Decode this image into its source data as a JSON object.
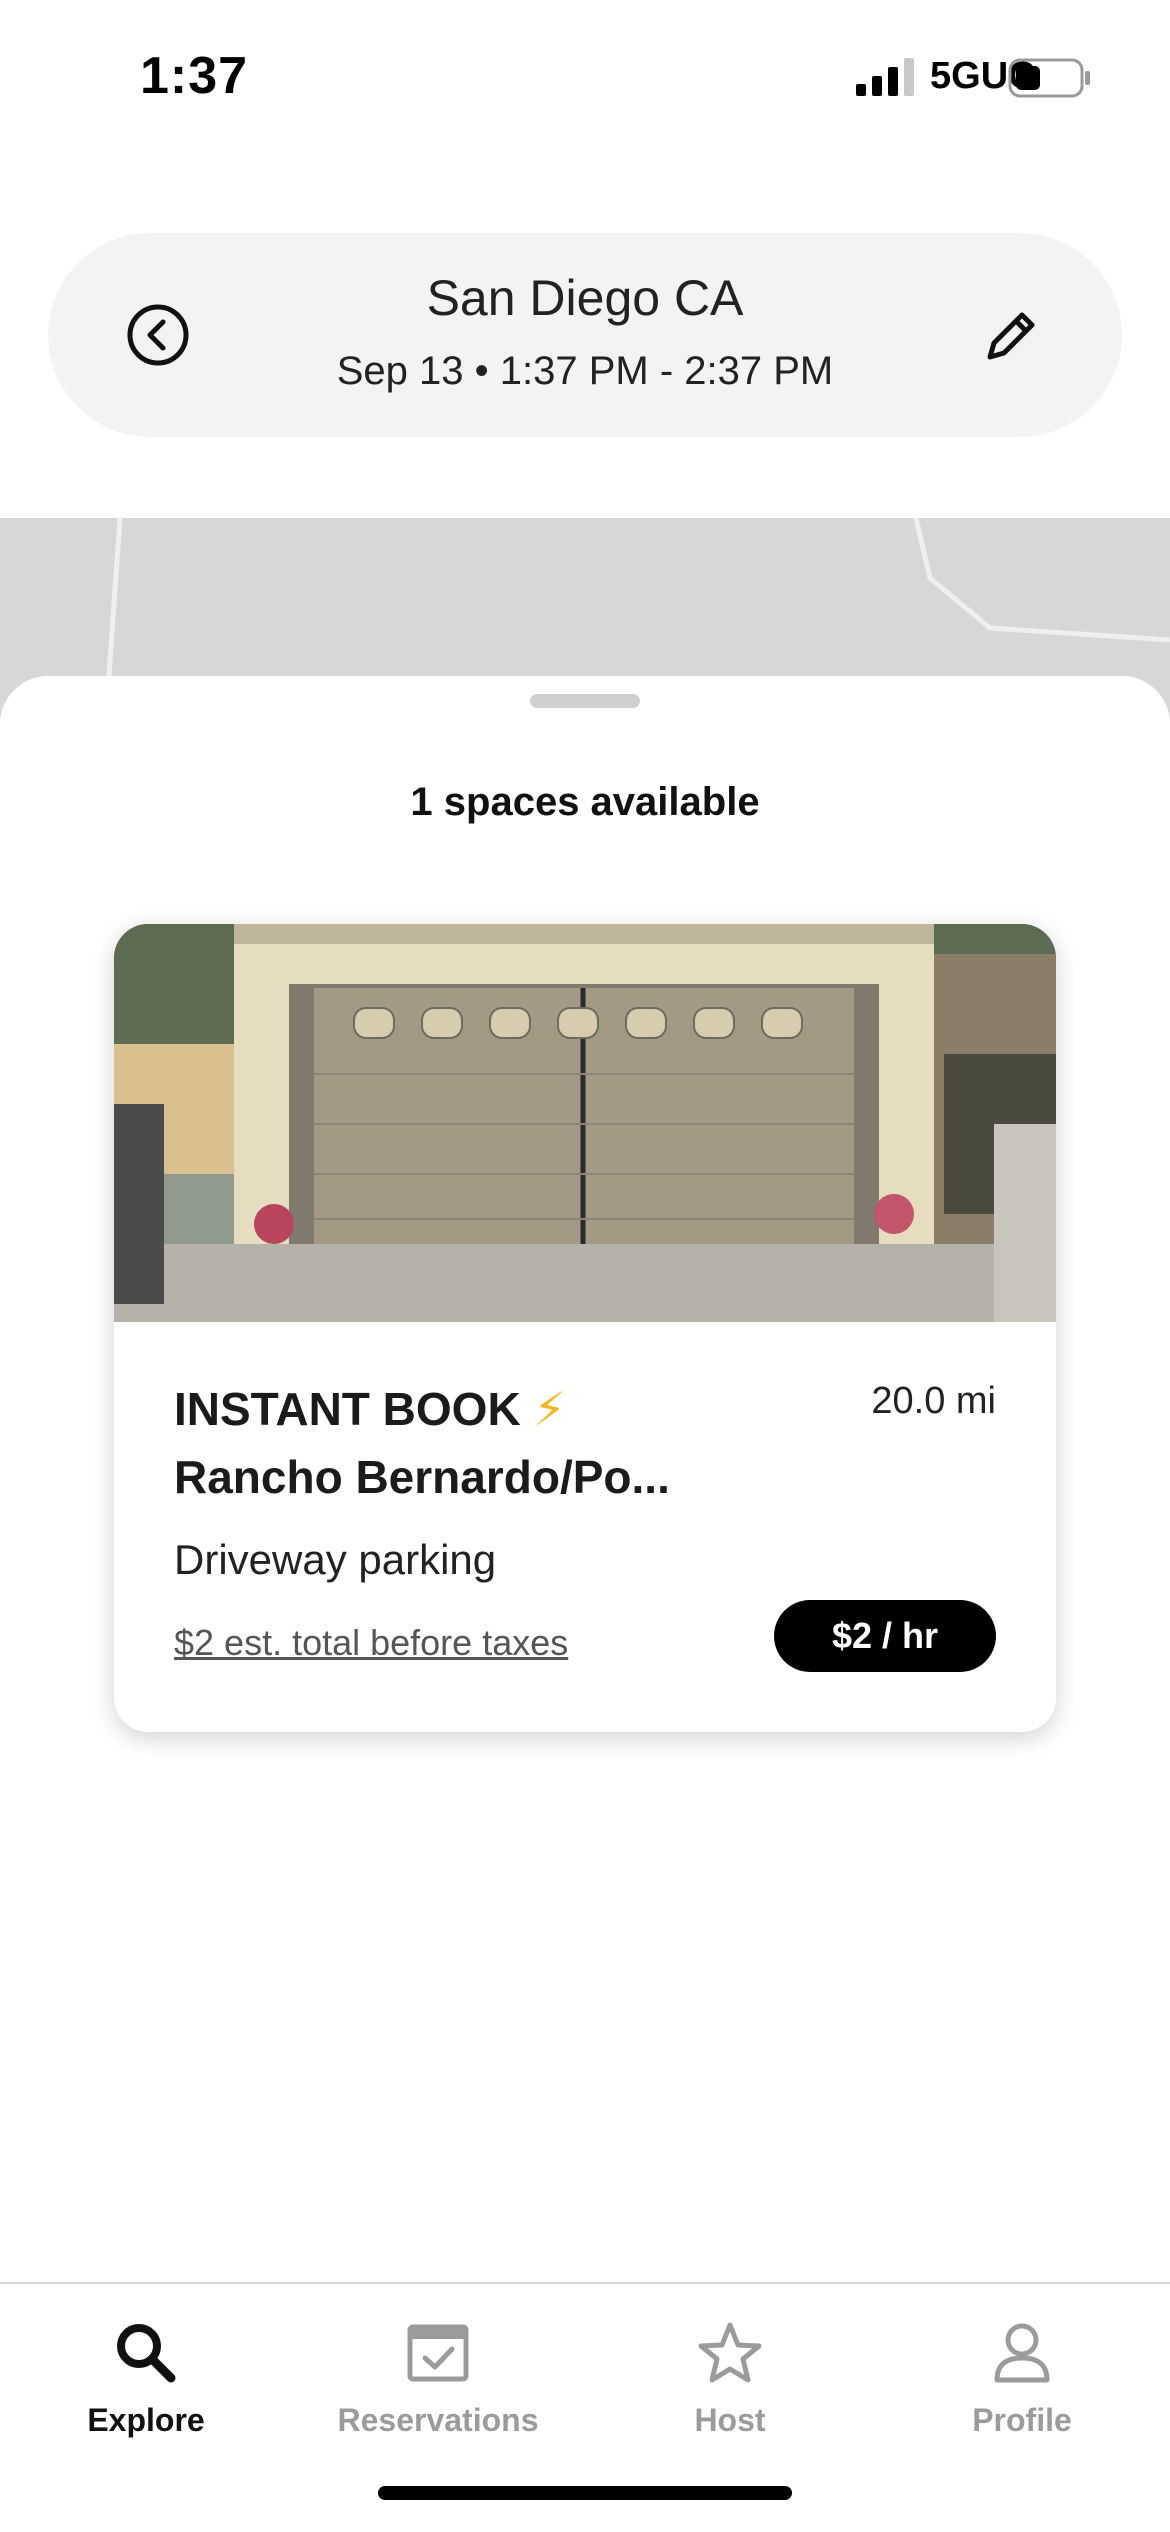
{
  "status_bar": {
    "time": "1:37",
    "network": "5GUC",
    "icons": [
      "signal-icon",
      "battery-icon"
    ]
  },
  "search": {
    "location": "San Diego CA",
    "datetime": "Sep 13 • 1:37 PM - 2:37 PM",
    "back_icon": "chevron-left-circle-icon",
    "edit_icon": "pencil-icon"
  },
  "sheet": {
    "title": "1 spaces available"
  },
  "listing": {
    "badge": "INSTANT BOOK",
    "badge_icon": "⚡",
    "name": "Rancho Bernardo/Po...",
    "distance": "20.0 mi",
    "type": "Driveway parking",
    "estimate": "$2 est. total before taxes",
    "price": "$2 / hr"
  },
  "tabs": [
    {
      "label": "Explore",
      "icon": "search-icon",
      "active": true
    },
    {
      "label": "Reservations",
      "icon": "calendar-check-icon",
      "active": false
    },
    {
      "label": "Host",
      "icon": "star-icon",
      "active": false
    },
    {
      "label": "Profile",
      "icon": "person-icon",
      "active": false
    }
  ],
  "colors": {
    "accent": "#000000",
    "bolt": "#f2b824",
    "inactive_tab": "#9b9b9b",
    "pill_bg": "#f3f3f1"
  }
}
